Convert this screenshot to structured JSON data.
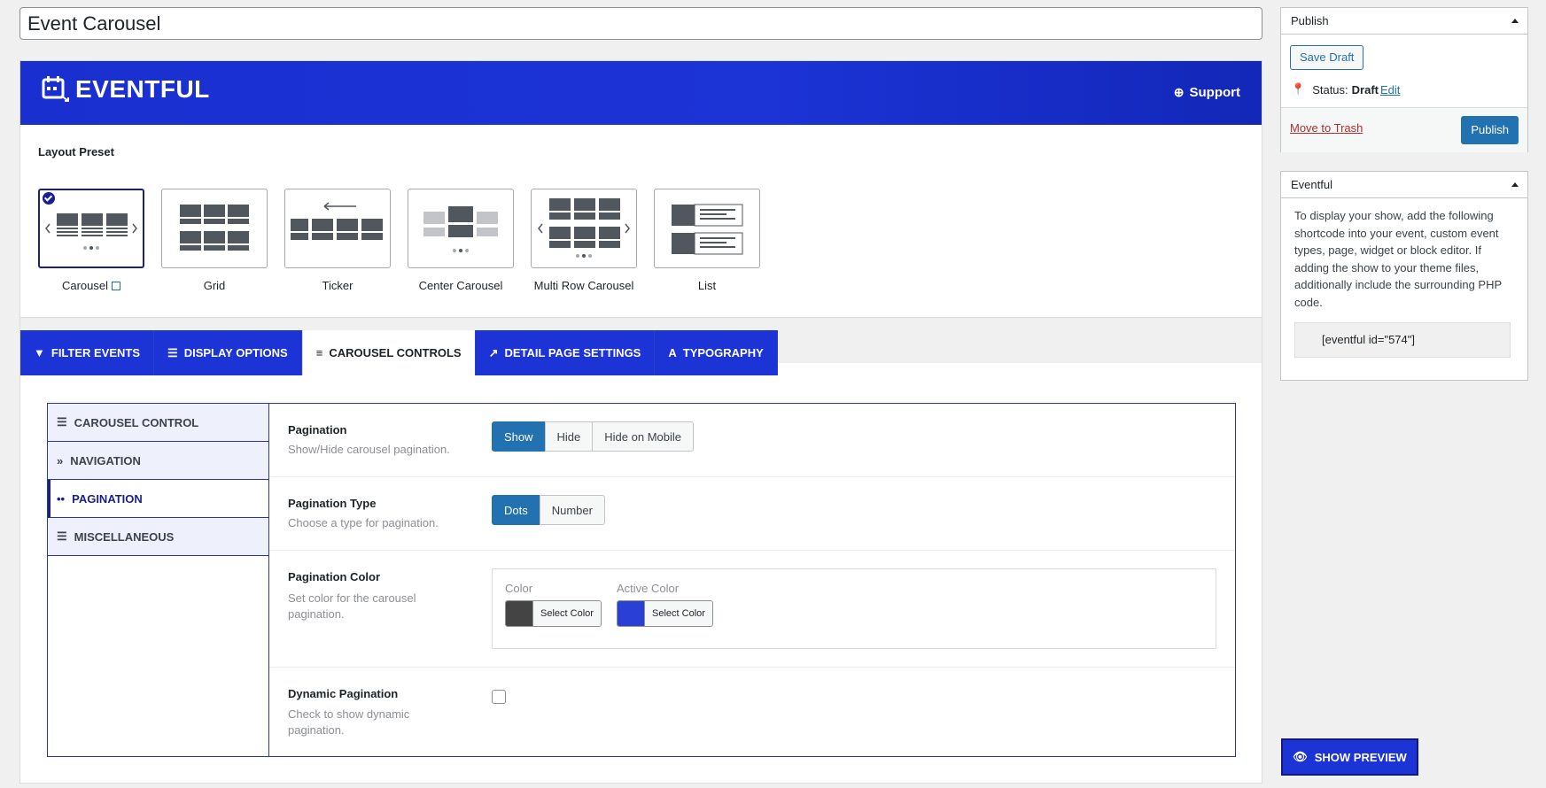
{
  "post_title": "Event Carousel",
  "banner": {
    "brand": "EVENTFUL",
    "support_label": "Support"
  },
  "layout": {
    "label": "Layout Preset",
    "presets": [
      {
        "label": "Carousel",
        "active": true
      },
      {
        "label": "Grid"
      },
      {
        "label": "Ticker"
      },
      {
        "label": "Center Carousel"
      },
      {
        "label": "Multi Row Carousel"
      },
      {
        "label": "List"
      }
    ]
  },
  "tabs": [
    {
      "label": "FILTER EVENTS",
      "icon": "filter-icon"
    },
    {
      "label": "DISPLAY OPTIONS",
      "icon": "list-icon"
    },
    {
      "label": "CAROUSEL CONTROLS",
      "icon": "sliders-icon",
      "active": true
    },
    {
      "label": "DETAIL PAGE SETTINGS",
      "icon": "external-link-icon"
    },
    {
      "label": "TYPOGRAPHY",
      "icon": "typography-icon"
    }
  ],
  "subnav": [
    {
      "label": "CAROUSEL CONTROL"
    },
    {
      "label": "NAVIGATION"
    },
    {
      "label": "PAGINATION",
      "active": true
    },
    {
      "label": "MISCELLANEOUS"
    }
  ],
  "settings": {
    "pagination": {
      "label": "Pagination",
      "desc": "Show/Hide carousel pagination.",
      "options": [
        "Show",
        "Hide",
        "Hide on Mobile"
      ],
      "selected": "Show"
    },
    "pagination_type": {
      "label": "Pagination Type",
      "desc": "Choose a type for pagination.",
      "options": [
        "Dots",
        "Number"
      ],
      "selected": "Dots"
    },
    "pagination_color": {
      "label": "Pagination Color",
      "desc": "Set color for the carousel pagination.",
      "color_label": "Color",
      "active_color_label": "Active Color",
      "select_label": "Select Color",
      "color": "#444444",
      "active_color": "#2a3fd6"
    },
    "dynamic_pagination": {
      "label": "Dynamic Pagination",
      "desc": "Check to show dynamic pagination.",
      "checked": false
    }
  },
  "publish_box": {
    "title": "Publish",
    "save_draft": "Save Draft",
    "status_label": "Status:",
    "status_value": "Draft",
    "edit_link": "Edit",
    "trash_link": "Move to Trash",
    "publish_button": "Publish"
  },
  "eventful_box": {
    "title": "Eventful",
    "description": "To display your show, add the following shortcode into your event, custom event types, page, widget or block editor. If adding the show to your theme files, additionally include the surrounding PHP code.",
    "shortcode": "[eventful id=\"574\"]"
  },
  "preview_button": "SHOW PREVIEW"
}
